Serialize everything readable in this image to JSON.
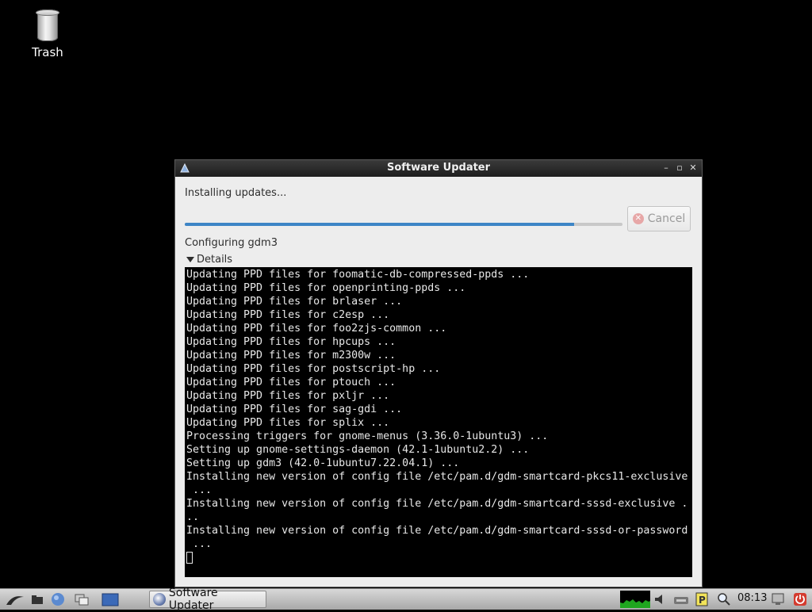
{
  "desktop": {
    "icons": [
      {
        "label": "Trash",
        "icon": "trash-icon"
      }
    ]
  },
  "window": {
    "title": "Software Updater",
    "controls": [
      "minimize-icon",
      "maximize-icon",
      "close-icon"
    ],
    "status": "Installing updates...",
    "progress": 0.89,
    "cancel_label": "Cancel",
    "subtask": "Configuring gdm3",
    "details_label": "Details",
    "terminal_lines": [
      "Updating PPD files for foomatic-db-compressed-ppds ...",
      "Updating PPD files for openprinting-ppds ...",
      "Updating PPD files for brlaser ...",
      "Updating PPD files for c2esp ...",
      "Updating PPD files for foo2zjs-common ...",
      "Updating PPD files for hpcups ...",
      "Updating PPD files for m2300w ...",
      "Updating PPD files for postscript-hp ...",
      "Updating PPD files for ptouch ...",
      "Updating PPD files for pxljr ...",
      "Updating PPD files for sag-gdi ...",
      "Updating PPD files for splix ...",
      "Processing triggers for gnome-menus (3.36.0-1ubuntu3) ...",
      "Setting up gnome-settings-daemon (42.1-1ubuntu2.2) ...",
      "Setting up gdm3 (42.0-1ubuntu7.22.04.1) ...",
      "Installing new version of config file /etc/pam.d/gdm-smartcard-pkcs11-exclusive",
      " ...",
      "Installing new version of config file /etc/pam.d/gdm-smartcard-sssd-exclusive .",
      "..",
      "Installing new version of config file /etc/pam.d/gdm-smartcard-sssd-or-password",
      " ..."
    ]
  },
  "taskbar": {
    "launchers": [
      "start-menu-icon",
      "file-manager-icon",
      "web-browser-icon",
      "window-switcher-icon",
      "desktop-icon"
    ],
    "task_label": "Software Updater",
    "tray": [
      "cpu-monitor-icon",
      "volume-icon",
      "network-icon",
      "clipboard-icon",
      "search-icon"
    ],
    "clock": "08:13",
    "end": [
      "lock-screen-icon",
      "power-icon"
    ]
  }
}
